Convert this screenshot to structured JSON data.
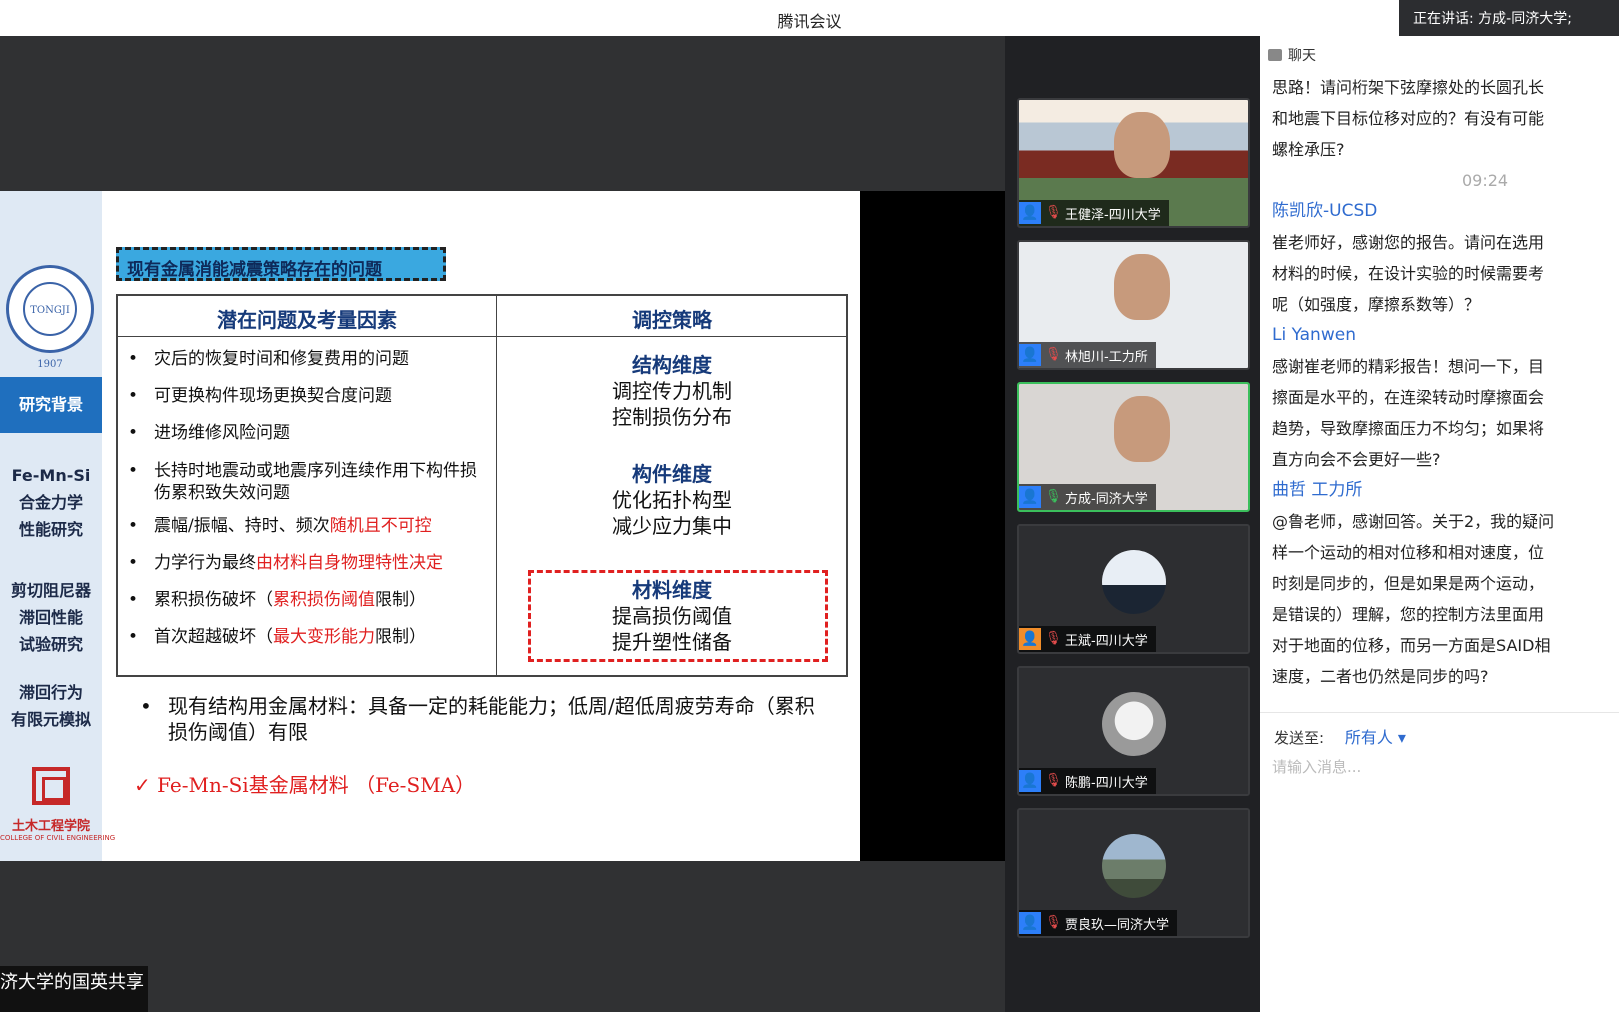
{
  "window": {
    "title": "腾讯会议",
    "speaking": "正在讲话: 方成-同济大学;"
  },
  "slide": {
    "logo_text": "TONGJI 1907",
    "sidebar": [
      {
        "label": "研究背景"
      },
      {
        "label": "Fe-Mn-Si\n合金力学\n性能研究"
      },
      {
        "label": "剪切阻尼器\n滞回性能\n试验研究"
      },
      {
        "label": "滞回行为\n有限元模拟"
      }
    ],
    "college_cn": "土木工程学院",
    "college_en": "COLLEGE OF CIVIL ENGINEERING",
    "heading": "现有金属消能减震策略存在的问题",
    "table": {
      "col_left": "潜在问题及考量因素",
      "col_right": "调控策略",
      "issues": [
        {
          "text": "灾后的恢复时间和修复费用的问题",
          "pre": "",
          "hl": "",
          "post": ""
        },
        {
          "text": "可更换构件现场更换契合度问题",
          "pre": "",
          "hl": "",
          "post": ""
        },
        {
          "text": "进场维修风险问题",
          "pre": "",
          "hl": "",
          "post": ""
        },
        {
          "text": "长持时地震动或地震序列连续作用下构件损伤累积致失效问题",
          "pre": "",
          "hl": "",
          "post": ""
        },
        {
          "text": "",
          "pre": "震幅/振幅、持时、频次",
          "hl": "随机且不可控",
          "post": ""
        },
        {
          "text": "",
          "pre": "力学行为最终",
          "hl": "由材料自身物理特性决定",
          "post": ""
        },
        {
          "text": "",
          "pre": "累积损伤破坏（",
          "hl": "累积损伤阈值",
          "post": "限制）"
        },
        {
          "text": "",
          "pre": "首次超越破坏（",
          "hl": "最大变形能力",
          "post": "限制）"
        }
      ],
      "strategies": [
        {
          "title": "结构维度",
          "line1": "调控传力机制",
          "line2": "控制损伤分布"
        },
        {
          "title": "构件维度",
          "line1": "优化拓扑构型",
          "line2": "减少应力集中"
        },
        {
          "title": "材料维度",
          "line1": "提高损伤阈值",
          "line2": "提升塑性储备"
        }
      ]
    },
    "note": "现有结构用金属材料：具备一定的耗能能力；低周/超低周疲劳寿命（累积损伤阈值）有限",
    "conclusion": "✓  Fe-Mn-Si基金属材料 （Fe-SMA）"
  },
  "caption": "济大学的国英共享",
  "participants": [
    {
      "name": "王健泽-四川大学",
      "mic": "muted",
      "active": false,
      "kind": "video"
    },
    {
      "name": "林旭川-工力所",
      "mic": "muted",
      "active": false,
      "kind": "video"
    },
    {
      "name": "方成-同济大学",
      "mic": "on",
      "active": true,
      "kind": "video"
    },
    {
      "name": "王斌-四川大学",
      "mic": "muted",
      "active": false,
      "kind": "avatar"
    },
    {
      "name": "陈鹏-四川大学",
      "mic": "muted",
      "active": false,
      "kind": "avatar"
    },
    {
      "name": "贾良玖—同济大学",
      "mic": "muted",
      "active": false,
      "kind": "avatar"
    }
  ],
  "chat": {
    "header": "聊天",
    "messages": [
      {
        "type": "text",
        "text": "思路！请问桁架下弦摩擦处的长圆孔长"
      },
      {
        "type": "text",
        "text": "和地震下目标位移对应的？有没有可能"
      },
      {
        "type": "text",
        "text": "螺栓承压?"
      },
      {
        "type": "time",
        "text": "09:24"
      },
      {
        "type": "sender",
        "text": "陈凯欣-UCSD"
      },
      {
        "type": "text",
        "text": "崔老师好，感谢您的报告。请问在选用"
      },
      {
        "type": "text",
        "text": "材料的时候，在设计实验的时候需要考"
      },
      {
        "type": "text",
        "text": "呢（如强度，摩擦系数等）？"
      },
      {
        "type": "sender",
        "text": "Li Yanwen"
      },
      {
        "type": "text",
        "text": "感谢崔老师的精彩报告！想问一下，目"
      },
      {
        "type": "text",
        "text": "擦面是水平的，在连梁转动时摩擦面会"
      },
      {
        "type": "text",
        "text": "趋势，导致摩擦面压力不均匀；如果将"
      },
      {
        "type": "text",
        "text": "直方向会不会更好一些?"
      },
      {
        "type": "sender",
        "text": "曲哲 工力所"
      },
      {
        "type": "text",
        "text": "@鲁老师，感谢回答。关于2，我的疑问"
      },
      {
        "type": "text",
        "text": "样一个运动的相对位移和相对速度，位"
      },
      {
        "type": "text",
        "text": "时刻是同步的，但是如果是两个运动，"
      },
      {
        "type": "text",
        "text": "是错误的）理解，您的控制方法里面用"
      },
      {
        "type": "text",
        "text": "对于地面的位移，而另一方面是SAID相"
      },
      {
        "type": "text",
        "text": "速度，二者也仍然是同步的吗?"
      }
    ],
    "send_to_label": "发送至:",
    "send_to_target": "所有人 ▾",
    "input_placeholder": "请输入消息..."
  }
}
